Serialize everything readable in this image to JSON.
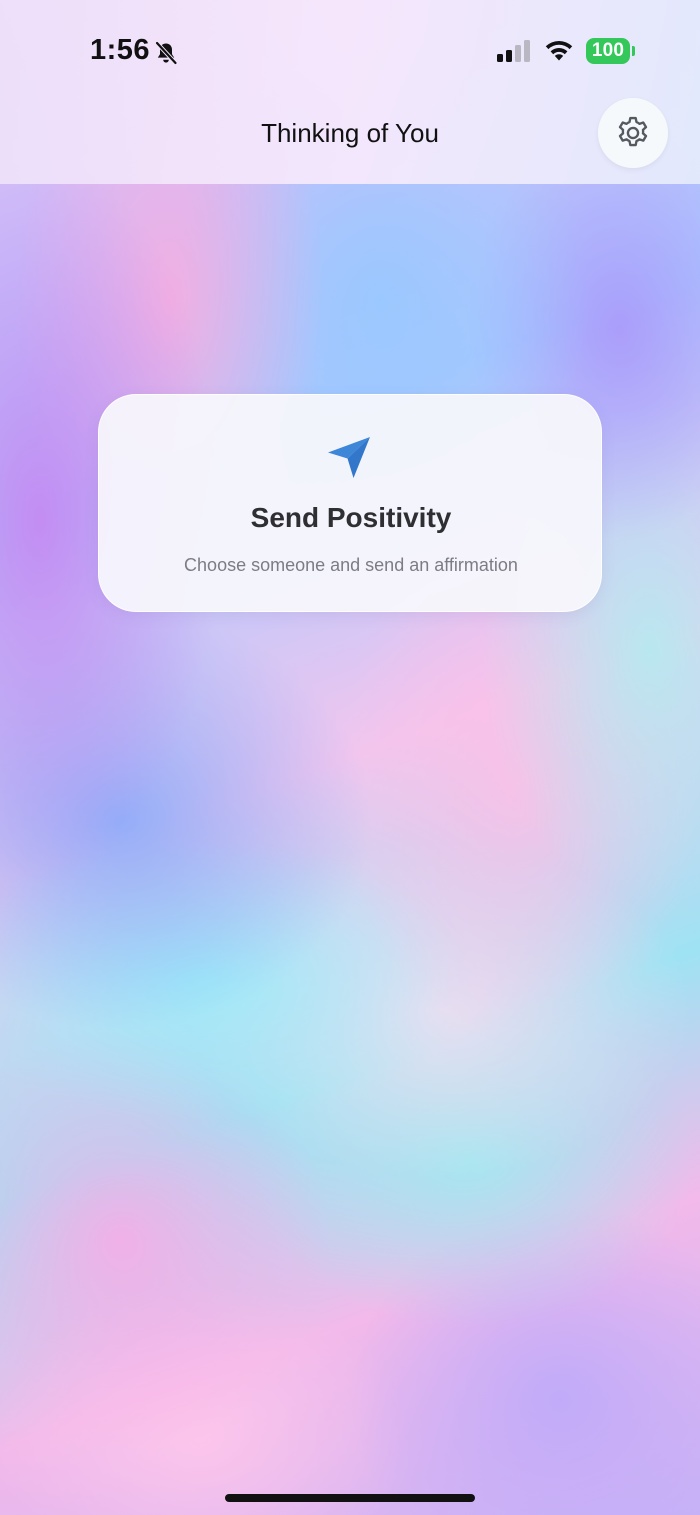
{
  "status_bar": {
    "time": "1:56",
    "silent_icon": "bell-slash-icon",
    "signal_icon": "cellular-signal-icon",
    "wifi_icon": "wifi-icon",
    "battery_level": "100",
    "battery_color": "#34c759"
  },
  "header": {
    "title": "Thinking of You",
    "settings_icon": "gear-icon"
  },
  "send_card": {
    "icon": "paper-plane-icon",
    "icon_color": "#3d86d8",
    "title": "Send Positivity",
    "subtitle": "Choose someone and send an affirmation"
  }
}
